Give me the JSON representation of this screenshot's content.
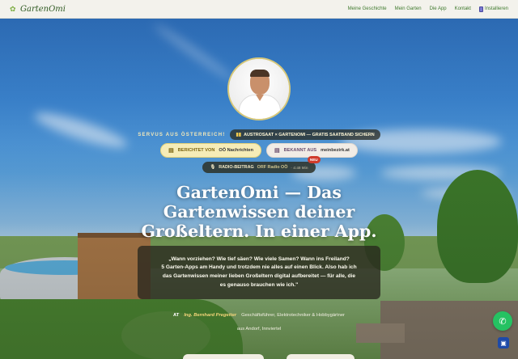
{
  "nav": {
    "logo_text": "GartenOmi",
    "links": [
      "Meine Geschichte",
      "Mein Garten",
      "Die App",
      "Kontakt"
    ],
    "install_label": "Installieren"
  },
  "hero": {
    "greeting": "SERVUS AUS ÖSTERREICH!",
    "promo": "AUSTROSAAT × GARTENOMI — GRATIS SAATBAND SICHERN",
    "press1_label": "BERICHTET VON",
    "press1_source": "OÖ Nachrichten",
    "press2_label": "BEKANNT AUS",
    "press2_source": "meinbezirk.at",
    "radio_label": "RADIO-BEITRAG",
    "radio_source": "ORF Radio OÖ",
    "radio_duration": "· 4:48 Min",
    "new_badge": "NEU",
    "title_lines": [
      "GartenOmi — Das",
      "Gartenwissen deiner",
      "Großeltern. In einer App."
    ],
    "quote_lines": [
      "„Wann vorziehen? Wie tief säen? Wie viele Samen? Wann ins Freiland?",
      "5 Garten-Apps am Handy und trotzdem nie alles auf einen Blick. Also hab ich",
      "das Gartenwissen meiner lieben Großeltern digital aufbereitet — für alle, die",
      "es genauso brauchen wie ich.\""
    ],
    "author_flag": "AT",
    "author_name": "Ing. Bernhard Pregetter",
    "author_role": "Geschäftsführer, Elektrotechniker & Hobbygärtner",
    "author_location": "aus Andorf, Innviertel"
  },
  "icons": {
    "logo": "sprout-icon",
    "install": "phone-icon",
    "promo": "gift-icon",
    "press1": "newspaper-icon",
    "press2": "newspaper-icon",
    "radio": "microphone-icon",
    "whatsapp": "whatsapp-icon",
    "corner": "chat-icon"
  },
  "colors": {
    "nav_bg": "#f3f2ec",
    "nav_link": "#3f7a2e",
    "accent_gold": "#f4d57a",
    "whatsapp": "#25c262",
    "badge_new": "#d03b2b"
  }
}
